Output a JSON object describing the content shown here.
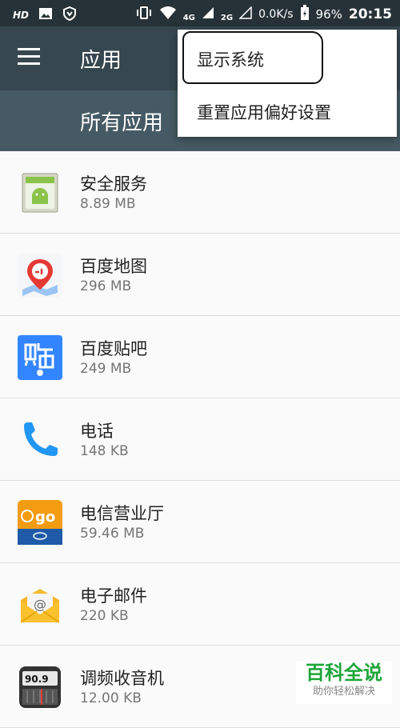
{
  "status_bar": {
    "hd": "HD",
    "net_4g": "4G",
    "net_2g": "2G",
    "speed": "0.0K/s",
    "battery": "96%",
    "time": "20:15"
  },
  "toolbar": {
    "title": "应用"
  },
  "subheader": {
    "label": "所有应用"
  },
  "overflow_menu": {
    "items": [
      {
        "label": "显示系统"
      },
      {
        "label": "重置应用偏好设置"
      }
    ]
  },
  "apps": [
    {
      "name": "安全服务",
      "size": "8.89 MB",
      "icon": "android-security-icon"
    },
    {
      "name": "百度地图",
      "size": "296 MB",
      "icon": "baidu-map-icon"
    },
    {
      "name": "百度贴吧",
      "size": "249 MB",
      "icon": "baidu-tieba-icon"
    },
    {
      "name": "电话",
      "size": "148 KB",
      "icon": "phone-icon"
    },
    {
      "name": "电信营业厅",
      "size": "59.46 MB",
      "icon": "telecom-icon"
    },
    {
      "name": "电子邮件",
      "size": "220 KB",
      "icon": "email-icon"
    },
    {
      "name": "调频收音机",
      "size": "12.00 KB",
      "icon": "fm-radio-icon",
      "badge": "90.9"
    }
  ],
  "watermark": {
    "main": "百科全说",
    "sub": "助你轻松解决"
  },
  "colors": {
    "status_bar": "#263238",
    "toolbar": "#37474f",
    "subheader": "#455a64"
  }
}
